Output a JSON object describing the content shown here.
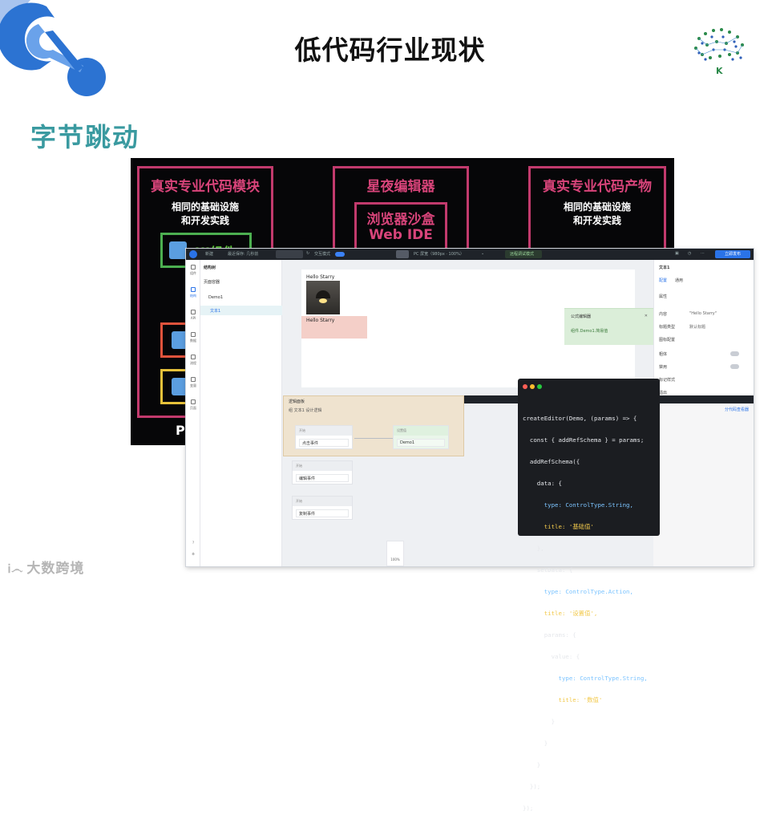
{
  "slide": {
    "title": "低代码行业现状",
    "brand": "字节跳动",
    "watermark": "大数跨境",
    "watermark_mark": "Ꭵ෴"
  },
  "diagram": {
    "left_box": {
      "title": "真实专业代码模块",
      "subtitle_1": "相同的基础设施",
      "subtitle_2": "和开发实践",
      "inner_label": "UI组件"
    },
    "center_box": {
      "title": "星夜编辑器",
      "inner_title_1": "浏览器沙盒",
      "inner_title_2": "Web IDE"
    },
    "right_box": {
      "title": "真实专业代码产物",
      "subtitle_1": "相同的基础设施",
      "subtitle_2": "和开发实践"
    },
    "bottom_left_letter": "P"
  },
  "app": {
    "topbar": {
      "app_name": "新建",
      "saved_at": "最近保存: 几秒前",
      "preview_mode": "交互模式",
      "device": "PC 屏宽（980px · 100%）",
      "remote_debug": "远程调试模式",
      "publish": "立即发布"
    },
    "iconbar": [
      "组件",
      "结构",
      "API",
      "数据",
      "流程",
      "变量",
      "页面"
    ],
    "tree": {
      "title": "结构树",
      "items": [
        "页面容器",
        "Demo1",
        "文本1"
      ]
    },
    "canvas": {
      "hello_1": "Hello Starry",
      "hello_2": "Hello Starry"
    },
    "formula": {
      "title": "公式编辑器",
      "body": "组件.Demo1.简易值"
    },
    "props": {
      "title": "文本1",
      "tabs": [
        "配置",
        "通用"
      ],
      "section": "属性",
      "rows": [
        {
          "label": "内容",
          "value": "\"Hello Starry\""
        },
        {
          "label": "标题类型",
          "value": "默认标题"
        },
        {
          "label": "图标配置",
          "value": ""
        },
        {
          "label": "粗体",
          "value": ""
        },
        {
          "label": "禁用",
          "value": ""
        },
        {
          "label": "标记样式",
          "value": ""
        },
        {
          "label": "溢出",
          "value": ""
        }
      ],
      "link": "分代码查看器"
    },
    "logic": {
      "title": "逻辑面板",
      "subtitle": "组 文本1 设计逻辑",
      "nodes": [
        {
          "head": "开始",
          "body": "点击事件"
        },
        {
          "head": "设置值",
          "body": "Demo1"
        },
        {
          "head": "开始",
          "body": "编辑事件"
        },
        {
          "head": "开始",
          "body": "复制事件"
        }
      ]
    },
    "zoom": "100%"
  },
  "code": {
    "lines": [
      "createEditor(Demo, (params) => {",
      "  const { addRefSchema } = params;",
      "  addRefSchema({",
      "    data: {",
      "      type: ControlType.String,",
      "      title: '基础值'",
      "    },",
      "    setData: {",
      "      type: ControlType.Action,",
      "      title: '设置值',",
      "      params: {",
      "        value: {",
      "          type: ControlType.String,",
      "          title: '数值'",
      "        }",
      "      }",
      "    }",
      "  });",
      "});"
    ]
  },
  "colors": {
    "accent_pink": "#c23a6d",
    "brand_teal": "#3a9aa0",
    "brand_blue": "#2c73d2",
    "ui_blue": "#2a73e8"
  }
}
